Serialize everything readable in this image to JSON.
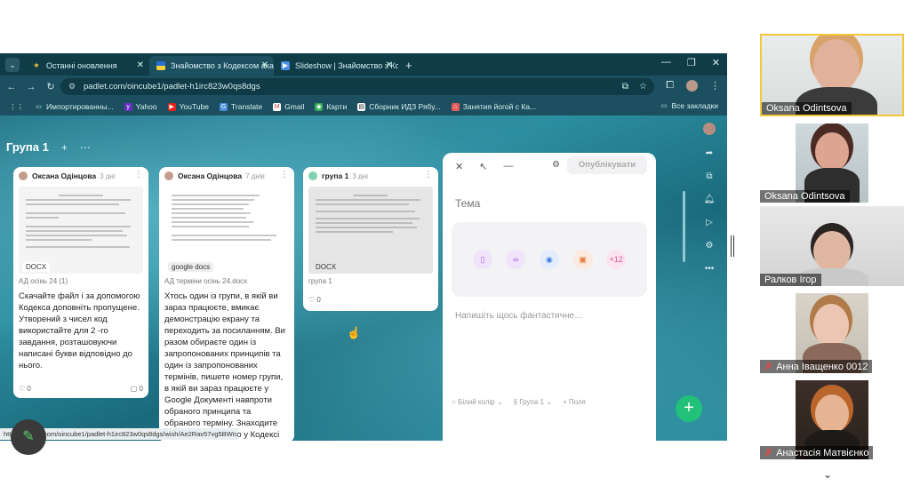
{
  "browser": {
    "tabs": [
      {
        "label": "Останні оновлення",
        "icon": "padlet-star-icon",
        "active": false
      },
      {
        "label": "Знайомство з Кодексом акад",
        "icon": "ukraine-flag-icon",
        "active": true
      },
      {
        "label": "Slideshow | Знайомство з Коде",
        "icon": "slideshow-icon",
        "active": false
      }
    ],
    "address": "padlet.com/oincube1/padlet-h1irc823w0qs8dgs",
    "bookmarks": [
      {
        "label": "Импортированны...",
        "icon": "folder-icon"
      },
      {
        "label": "Yahoo",
        "icon": "yahoo-icon"
      },
      {
        "label": "YouTube",
        "icon": "youtube-icon"
      },
      {
        "label": "Translate",
        "icon": "translate-icon"
      },
      {
        "label": "Gmail",
        "icon": "gmail-icon"
      },
      {
        "label": "Карти",
        "icon": "maps-icon"
      },
      {
        "label": "Сборник ИДЗ Рябу...",
        "icon": "doc-icon"
      },
      {
        "label": "Занятия йогой с Ка...",
        "icon": "yoga-icon"
      }
    ],
    "all_bookmarks": "Все закладки",
    "status_url": "https://padlet.com/oincube1/padlet-h1irc823w0qs8dgs/wish/Ae2Rav57vg5BWnz4"
  },
  "padlet": {
    "section_title": "Група 1",
    "cards": [
      {
        "author": "Оксана Одінцова",
        "age": "3 дні",
        "badge": "DOCX",
        "meta": "АД осінь 24 (1)",
        "body": "Скачайте файл і за допомогою Кодекса доповніть пропущене. Утворений з чисел код використайте для 2 -го завдання, розташовуючи написані букви відповідно до нього.",
        "likes": "0",
        "comments": "0"
      },
      {
        "author": "Оксана Одінцова",
        "age": "7 днів",
        "badge": "google docs",
        "meta": "АД терміни осінь 24.docx",
        "body": "Хтось один із групи,  в якій ви зараз працюєте, вмикає демонстрацію екрану та переходить  за посиланням.  Ви разом обираєте один із запропонованих принципів та один із запропонованих термінів, пишете номер групи, в якій ви зараз працюєте у Google Документі навпроти обраного принципа та обраного терміну. Знаходите пояснення до нього у Кодексі академічної",
        "likes": "",
        "comments": ""
      },
      {
        "author": "група 1",
        "age": "3 дні",
        "badge": "DOCX",
        "meta": "група 1",
        "body": "",
        "likes": "0",
        "comments": ""
      }
    ],
    "editor": {
      "publish": "Опублікувати",
      "title_placeholder": "Тема",
      "body_placeholder": "Напишіть щось фантастичне…",
      "more_count": "+12",
      "color_label": "Білий колір",
      "group_label": "Група 1",
      "fields_label": "+ Поля"
    }
  },
  "participants": [
    {
      "name": "Oksana Odintsova",
      "muted": false
    },
    {
      "name": "Oksana Odintsova",
      "muted": false
    },
    {
      "name": "Ралков Ігор",
      "muted": false
    },
    {
      "name": "Анна Іващенко 0012",
      "muted": true
    },
    {
      "name": "Анастасія Матвієнко",
      "muted": true
    }
  ],
  "colors": {
    "fab_green": "#21c17a",
    "tab_bar": "#103c48",
    "browser_bg": "#1c5060"
  }
}
